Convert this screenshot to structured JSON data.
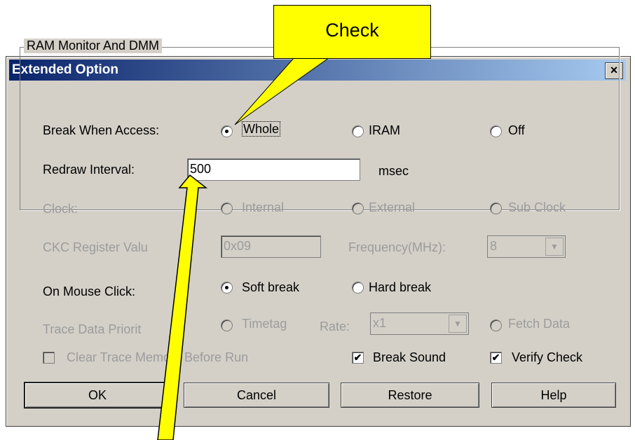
{
  "callout": {
    "text": "Check"
  },
  "window": {
    "title": "Extended Option",
    "close_glyph": "×"
  },
  "ram_group": {
    "label": "RAM Monitor And DMM",
    "break_when_access": {
      "label": "Break When Access:",
      "options": [
        "Whole",
        "IRAM",
        "Off"
      ],
      "selected": "Whole"
    },
    "redraw_interval": {
      "label": "Redraw Interval:",
      "value": "500",
      "unit": "msec"
    },
    "clock": {
      "label": "Clock:",
      "options": [
        "Internal",
        "External",
        "Sub Clock"
      ]
    },
    "ckc": {
      "label": "CKC Register Valu",
      "value": "0x09",
      "frequency_label": "Frequency(MHz):",
      "frequency_value": "8"
    }
  },
  "mouse_click": {
    "label": "On Mouse Click:",
    "options": [
      "Soft break",
      "Hard break"
    ],
    "selected": "Soft break"
  },
  "trace": {
    "label": "Trace Data Priorit",
    "timetag": "Timetag",
    "rate_label": "Rate:",
    "rate_value": "x1",
    "fetch": "Fetch Data"
  },
  "checks": {
    "clear_trace": {
      "label": "Clear Trace Memory Before Run",
      "checked": false
    },
    "break_sound": {
      "label": "Break Sound",
      "checked": true
    },
    "verify_check": {
      "label": "Verify Check",
      "checked": true
    }
  },
  "buttons": {
    "ok": "OK",
    "cancel": "Cancel",
    "restore": "Restore",
    "help": "Help"
  },
  "colors": {
    "callout": "#ffff00",
    "titlebar_start": "#0a246a",
    "titlebar_end": "#a6caf0",
    "dialog_bg": "#d4d0c8"
  }
}
